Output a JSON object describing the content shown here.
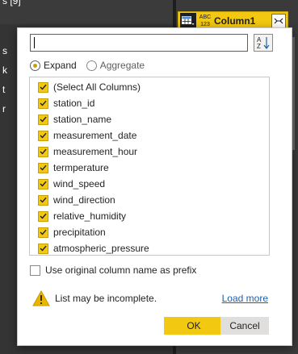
{
  "background": {
    "left_title": "s [9]",
    "left_fragments": [
      "s",
      "k",
      "t",
      "r"
    ]
  },
  "column_header": {
    "type_label": "ABC 123",
    "name": "Column1",
    "table_icon": "table-icon",
    "expand_icon": "expand-columns-icon"
  },
  "popup": {
    "search": {
      "value": "",
      "placeholder": ""
    },
    "sort_icon_label": "A Z",
    "modes": [
      {
        "label": "Expand",
        "selected": true
      },
      {
        "label": "Aggregate",
        "selected": false
      }
    ],
    "columns": [
      {
        "label": "(Select All Columns)",
        "checked": true
      },
      {
        "label": "station_id",
        "checked": true
      },
      {
        "label": "station_name",
        "checked": true
      },
      {
        "label": "measurement_date",
        "checked": true
      },
      {
        "label": "measurement_hour",
        "checked": true
      },
      {
        "label": "termperature",
        "checked": true
      },
      {
        "label": "wind_speed",
        "checked": true
      },
      {
        "label": "wind_direction",
        "checked": true
      },
      {
        "label": "relative_humidity",
        "checked": true
      },
      {
        "label": "precipitation",
        "checked": true
      },
      {
        "label": "atmospheric_pressure",
        "checked": true
      }
    ],
    "prefix_option": {
      "label": "Use original column name as prefix",
      "checked": false
    },
    "warning": {
      "icon": "warning-icon",
      "text": "List may be incomplete.",
      "link": "Load more"
    },
    "ok_label": "OK",
    "cancel_label": "Cancel"
  },
  "colors": {
    "accent": "#f2c811",
    "link": "#1f5fa8",
    "warning": "#e8b500"
  }
}
